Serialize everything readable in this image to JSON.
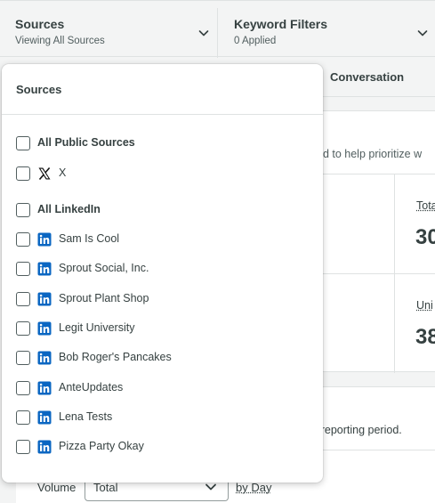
{
  "filters": {
    "sources": {
      "title": "Sources",
      "subtitle": "Viewing All Sources"
    },
    "keywords": {
      "title": "Keyword Filters",
      "subtitle": "0 Applied"
    }
  },
  "background": {
    "tab_conversation": "Conversation",
    "description_fragment": "od to help prioritize w",
    "stat1_label": "Tota",
    "stat1_value": "30",
    "stat2_label": "Uni",
    "stat2_value": "38",
    "period_fragment": "s reporting period.",
    "volume_label": "Volume",
    "volume_select_value": "Total",
    "by_day": "by Day"
  },
  "dropdown": {
    "title": "Sources",
    "options": [
      {
        "label": "All Public Sources",
        "type": "group",
        "checked": false
      },
      {
        "label": "X",
        "type": "x",
        "icon": "x-icon",
        "checked": false
      },
      {
        "label": "All LinkedIn",
        "type": "group",
        "checked": false
      },
      {
        "label": "Sam Is Cool",
        "type": "linkedin",
        "icon": "linkedin-icon",
        "checked": false
      },
      {
        "label": "Sprout Social, Inc.",
        "type": "linkedin",
        "icon": "linkedin-icon",
        "checked": false
      },
      {
        "label": "Sprout Plant Shop",
        "type": "linkedin",
        "icon": "linkedin-icon",
        "checked": false
      },
      {
        "label": "Legit University",
        "type": "linkedin",
        "icon": "linkedin-icon",
        "checked": false
      },
      {
        "label": "Bob Roger's Pancakes",
        "type": "linkedin",
        "icon": "linkedin-icon",
        "checked": false
      },
      {
        "label": "AnteUpdates",
        "type": "linkedin",
        "icon": "linkedin-icon",
        "checked": false
      },
      {
        "label": "Lena Tests",
        "type": "linkedin",
        "icon": "linkedin-icon",
        "checked": false
      },
      {
        "label": "Pizza Party Okay",
        "type": "linkedin",
        "icon": "linkedin-icon",
        "checked": false
      }
    ]
  },
  "colors": {
    "linkedin": "#0a66c2",
    "text": "#364141",
    "border": "#dfe2e2"
  }
}
